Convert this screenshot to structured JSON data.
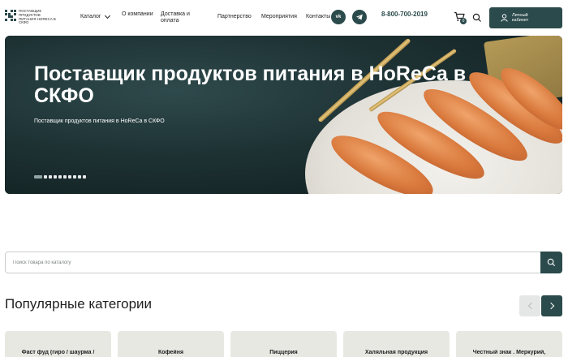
{
  "header": {
    "logo_text": "Поставщик продуктов питания HoReCa в СКФО",
    "nav": {
      "catalog": "Каталог",
      "about": "О компании",
      "delivery": "Доставка и оплата",
      "partnership": "Партнерство",
      "events": "Мероприятия",
      "contacts": "Контакты"
    },
    "social": {
      "vk": "vk-icon",
      "telegram": "telegram-icon"
    },
    "phone": "8-800-700-2019",
    "cart_count": "0",
    "cabinet_label": "Личный кабинет"
  },
  "hero": {
    "title": "Поставщик продуктов питания в HoReCa в СКФО",
    "subtitle": "Поставщик продуктов питания в HoReCa в СКФО",
    "slides_count": 10,
    "active_slide": 1
  },
  "search": {
    "placeholder": "Поиск товара по каталогу"
  },
  "categories": {
    "title": "Популярные категории",
    "items": [
      {
        "label": "Фаст фуд (гиро / шаурма /"
      },
      {
        "label": "Кофейня"
      },
      {
        "label": "Пиццерия"
      },
      {
        "label": "Халяльная продукция"
      },
      {
        "label": "Честный знак . Меркурий,"
      }
    ]
  },
  "colors": {
    "accent": "#2b4a4b",
    "card_bg": "#e8e8e3"
  }
}
